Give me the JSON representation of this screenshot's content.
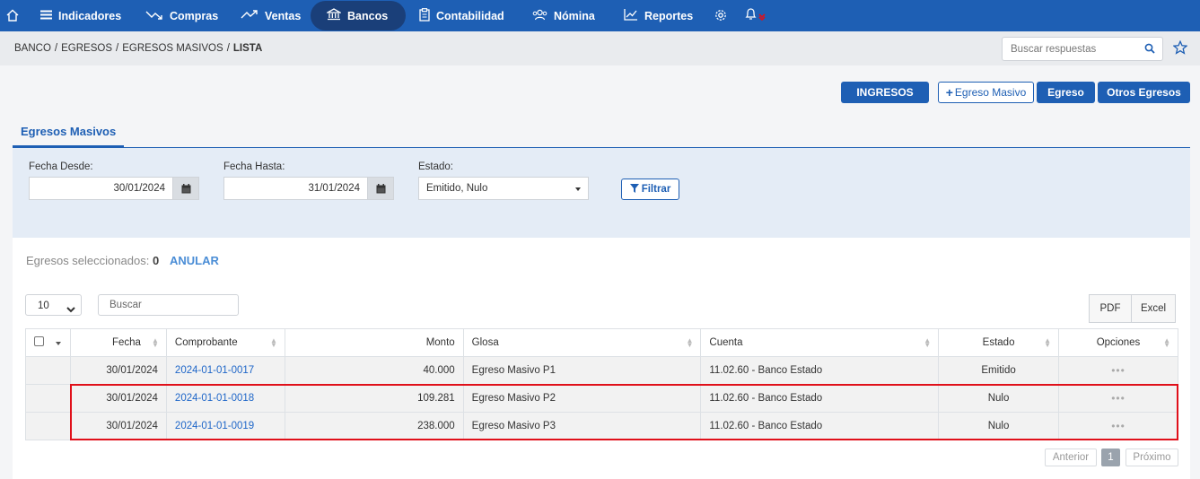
{
  "nav": {
    "items": [
      {
        "label": "Indicadores",
        "icon": "list-icon"
      },
      {
        "label": "Compras",
        "icon": "trend-down-icon"
      },
      {
        "label": "Ventas",
        "icon": "trend-up-icon"
      },
      {
        "label": "Bancos",
        "icon": "bank-icon"
      },
      {
        "label": "Contabilidad",
        "icon": "clipboard-icon"
      },
      {
        "label": "Nómina",
        "icon": "people-icon"
      },
      {
        "label": "Reportes",
        "icon": "chart-icon"
      }
    ],
    "active": "Bancos",
    "colors": {
      "bar": "#1e5fb4",
      "active": "#1a3f79",
      "notif": "#e0101a"
    }
  },
  "breadcrumb": [
    "BANCO",
    "EGRESOS",
    "EGRESOS MASIVOS",
    "LISTA"
  ],
  "search": {
    "placeholder": "Buscar respuestas"
  },
  "actions": {
    "ingresos": "INGRESOS",
    "egreso_masivo": "Egreso Masivo",
    "egreso": "Egreso",
    "otros_egresos": "Otros Egresos"
  },
  "tab": {
    "label": "Egresos Masivos"
  },
  "filter": {
    "fecha_desde_label": "Fecha Desde:",
    "fecha_desde": "30/01/2024",
    "fecha_hasta_label": "Fecha Hasta:",
    "fecha_hasta": "31/01/2024",
    "estado_label": "Estado:",
    "estado": "Emitido, Nulo",
    "filtrar": "Filtrar"
  },
  "selection": {
    "label": "Egresos seleccionados:",
    "count": "0",
    "anular": "ANULAR"
  },
  "table_controls": {
    "page_length": "10",
    "search_placeholder": "Buscar",
    "pdf": "PDF",
    "excel": "Excel"
  },
  "table": {
    "headers": [
      "Fecha",
      "Comprobante",
      "Monto",
      "Glosa",
      "Cuenta",
      "Estado",
      "Opciones"
    ],
    "rows": [
      {
        "fecha": "30/01/2024",
        "comprobante": "2024-01-01-0017",
        "monto": "40.000",
        "glosa": "Egreso Masivo P1",
        "cuenta": "11.02.60 - Banco Estado",
        "estado": "Emitido"
      },
      {
        "fecha": "30/01/2024",
        "comprobante": "2024-01-01-0018",
        "monto": "109.281",
        "glosa": "Egreso Masivo P2",
        "cuenta": "11.02.60 - Banco Estado",
        "estado": "Nulo"
      },
      {
        "fecha": "30/01/2024",
        "comprobante": "2024-01-01-0019",
        "monto": "238.000",
        "glosa": "Egreso Masivo P3",
        "cuenta": "11.02.60 - Banco Estado",
        "estado": "Nulo"
      }
    ],
    "options_glyph": "•••"
  },
  "pagination": {
    "prev": "Anterior",
    "current": "1",
    "next": "Próximo"
  }
}
